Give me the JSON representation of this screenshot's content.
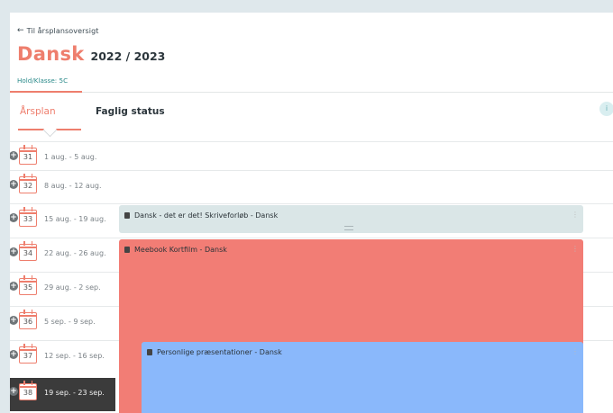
{
  "back_link": {
    "label": "Til årsplansoversigt"
  },
  "header": {
    "subject": "Dansk",
    "year": "2022 / 2023",
    "class_label": "Hold/Klasse: 5C"
  },
  "tabs": [
    {
      "label": "Årsplan",
      "active": true
    },
    {
      "label": "Faglig status",
      "active": false
    }
  ],
  "info_button": {
    "label": "i"
  },
  "weeks": [
    {
      "number": "31",
      "range": "1 aug. - 5 aug."
    },
    {
      "number": "32",
      "range": "8 aug. - 12 aug."
    },
    {
      "number": "33",
      "range": "15 aug. - 19 aug."
    },
    {
      "number": "34",
      "range": "22 aug. - 26 aug."
    },
    {
      "number": "35",
      "range": "29 aug. - 2 sep."
    },
    {
      "number": "36",
      "range": "5 sep. - 9 sep."
    },
    {
      "number": "37",
      "range": "12 sep. - 16 sep."
    },
    {
      "number": "38",
      "range": "19 sep. - 23 sep.",
      "active": true
    }
  ],
  "events": [
    {
      "title": "Dansk - det er det! Skriveforløb - Dansk",
      "color": "#dae6e7"
    },
    {
      "title": "Meebook Kortfilm - Dansk",
      "color": "#f27d75"
    },
    {
      "title": "Personlige præsentationer - Dansk",
      "color": "#8ab8fb"
    }
  ],
  "colors": {
    "accent": "#ee7e6d",
    "class_label": "#2a8a8a"
  },
  "icons": {
    "back": "arrow-left-icon",
    "add": "plus-icon",
    "calendar": "calendar-icon",
    "book": "book-icon",
    "menu": "kebab-menu-icon",
    "info": "info-icon"
  }
}
